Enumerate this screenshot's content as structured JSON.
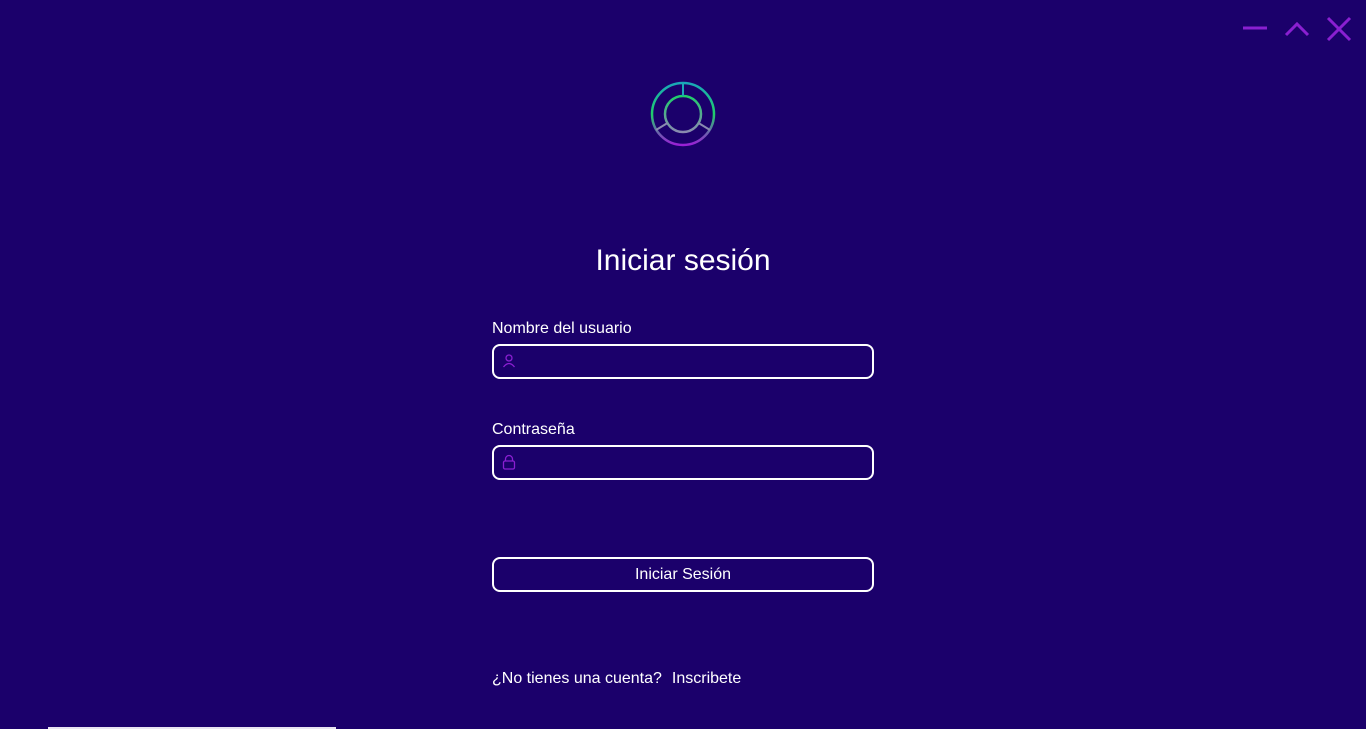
{
  "window": {
    "controls": {
      "minimize_icon": "minus-icon",
      "maximize_icon": "chevron-up-icon",
      "close_icon": "close-icon"
    }
  },
  "colors": {
    "background": "#1b006b",
    "accent": "#8a1fd1",
    "logo_teal": "#1aa7b8",
    "logo_green": "#1fce6a",
    "logo_purple": "#9b1fd6",
    "text": "#ffffff"
  },
  "login": {
    "title": "Iniciar sesión",
    "username": {
      "label": "Nombre del usuario",
      "value": "",
      "icon": "user-icon"
    },
    "password": {
      "label": "Contraseña",
      "value": "",
      "icon": "lock-icon"
    },
    "submit_label": "Iniciar Sesión",
    "signup_prompt": "¿No tienes una cuenta?",
    "signup_link": "Inscribete"
  }
}
